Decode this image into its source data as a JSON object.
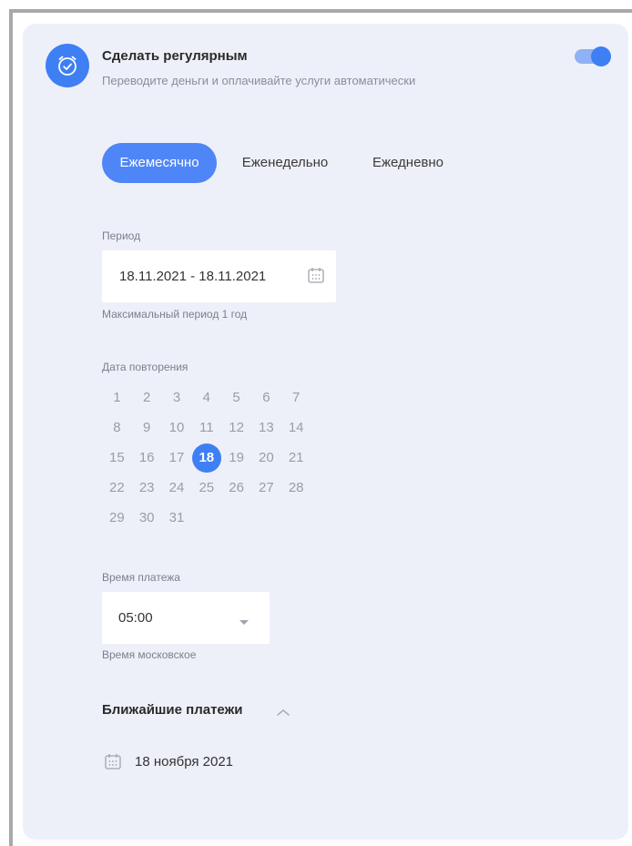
{
  "header": {
    "title": "Сделать регулярным",
    "subtitle": "Переводите деньги и оплачивайте услуги автоматически",
    "toggle_on": true
  },
  "frequency_tabs": [
    {
      "label": "Ежемесячно",
      "active": true
    },
    {
      "label": "Еженедельно",
      "active": false
    },
    {
      "label": "Ежедневно",
      "active": false
    }
  ],
  "period": {
    "label": "Период",
    "value": "18.11.2021 - 18.11.2021",
    "hint": "Максимальный период 1 год"
  },
  "repeat_date": {
    "label": "Дата повторения",
    "days": [
      "1",
      "2",
      "3",
      "4",
      "5",
      "6",
      "7",
      "8",
      "9",
      "10",
      "11",
      "12",
      "13",
      "14",
      "15",
      "16",
      "17",
      "18",
      "19",
      "20",
      "21",
      "22",
      "23",
      "24",
      "25",
      "26",
      "27",
      "28",
      "29",
      "30",
      "31"
    ],
    "selected": "18"
  },
  "payment_time": {
    "label": "Время платежа",
    "value": "05:00",
    "hint": "Время московское"
  },
  "upcoming": {
    "title": "Ближайшие платежи",
    "items": [
      "18 ноября 2021"
    ]
  },
  "colors": {
    "accent": "#3f7ff4",
    "card_background": "#eef0f9"
  }
}
